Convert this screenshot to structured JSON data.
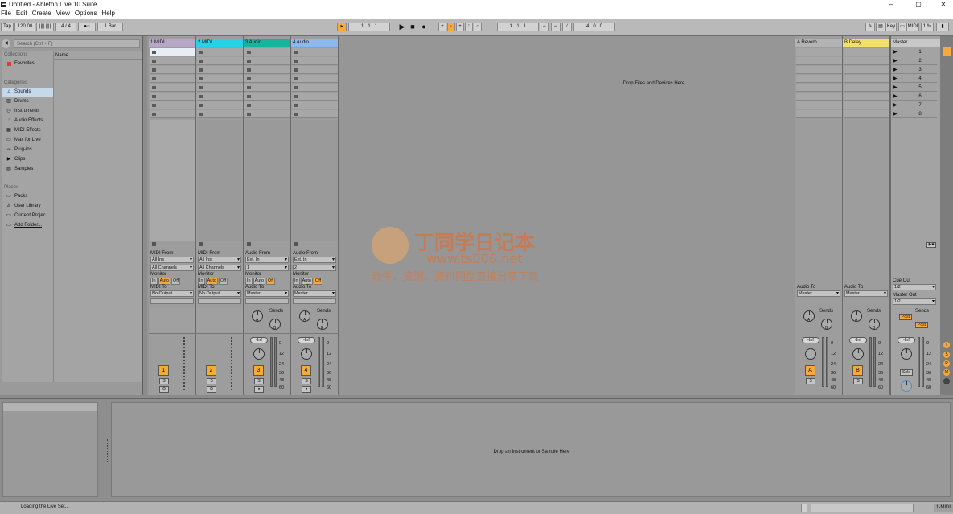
{
  "window": {
    "title": "Untitled - Ableton Live 10 Suite",
    "logo": "live",
    "minimize": "–",
    "maximize": "▢",
    "close": "✕"
  },
  "menu": [
    "File",
    "Edit",
    "Create",
    "View",
    "Options",
    "Help"
  ],
  "control_bar": {
    "tap": "Tap",
    "tempo": "120.00",
    "time_sig": "4 / 4",
    "quant": "1 Bar",
    "metro": "●○",
    "arrangement_position": "1 .  1 .  1",
    "loop_start": "3 .  1 .  1",
    "loop_length": "4 .  0 .  0",
    "key": "Key",
    "midi": "MIDI",
    "cpu": "1 %"
  },
  "browser": {
    "search_placeholder": "Search (Ctrl + F)",
    "collections_header": "Collections",
    "favorites": "Favorites",
    "categories_header": "Categories",
    "categories": [
      "Sounds",
      "Drums",
      "Instruments",
      "Audio Effects",
      "MIDI Effects",
      "Max for Live",
      "Plug-ins",
      "Clips",
      "Samples"
    ],
    "places_header": "Places",
    "places": [
      "Packs",
      "User Library",
      "Current Projec",
      "Add Folder..."
    ],
    "name_column": "Name"
  },
  "tracks": [
    {
      "name": "1 MIDI",
      "num": "1",
      "color": "#b7a6c6",
      "type": "midi",
      "from_label": "MIDI From",
      "from": "All Ins",
      "ch": "All Channels",
      "to_label": "MIDI To",
      "to": "No Output"
    },
    {
      "name": "2 MIDI",
      "num": "2",
      "color": "#27d1e8",
      "type": "midi",
      "from_label": "MIDI From",
      "from": "All Ins",
      "ch": "All Channels",
      "to_label": "MIDI To",
      "to": "No Output"
    },
    {
      "name": "3 Audio",
      "num": "3",
      "color": "#17b39f",
      "type": "audio",
      "from_label": "Audio From",
      "from": "Ext. In",
      "ch": "1",
      "to_label": "Audio To",
      "to": "Master"
    },
    {
      "name": "4 Audio",
      "num": "4",
      "color": "#8cb8f0",
      "type": "audio",
      "from_label": "Audio From",
      "from": "Ext. In",
      "ch": "2",
      "to_label": "Audio To",
      "to": "Master"
    }
  ],
  "monitor": {
    "label": "Monitor",
    "in": "In",
    "auto": "Auto",
    "off": "Off"
  },
  "sends_label": "Sends",
  "send_a": "A",
  "send_b": "B",
  "solo_label": "S",
  "vol_inf": "-Inf",
  "meter_scale": [
    "0",
    "12",
    "24",
    "36",
    "48",
    "60"
  ],
  "drop_files": "Drop Files and Devices Here",
  "returns": [
    {
      "name": "A Reverb",
      "color": "#b3b3b3",
      "num": "A",
      "to_label": "Audio To",
      "to": "Master"
    },
    {
      "name": "B Delay",
      "color": "#f3e06a",
      "num": "B",
      "to_label": "Audio To",
      "to": "Master"
    }
  ],
  "master": {
    "name": "Master",
    "color": "#c8c8c8",
    "cue_out_label": "Cue Out",
    "cue_out": "1/2",
    "master_out_label": "Master Out",
    "master_out": "1/2",
    "post": "Post",
    "solo": "Solo"
  },
  "scenes": [
    "1",
    "2",
    "3",
    "4",
    "5",
    "6",
    "7",
    "8"
  ],
  "drop_instrument": "Drop an Instrument or Sample Here",
  "status": {
    "text": "Loading the Live Set...",
    "midi_track": "1-MIDI"
  },
  "watermark": {
    "line1": "丁同学日记本",
    "line2": "www.ts006.net",
    "line3": "软件、资源、资料网盘直接分享下载"
  }
}
